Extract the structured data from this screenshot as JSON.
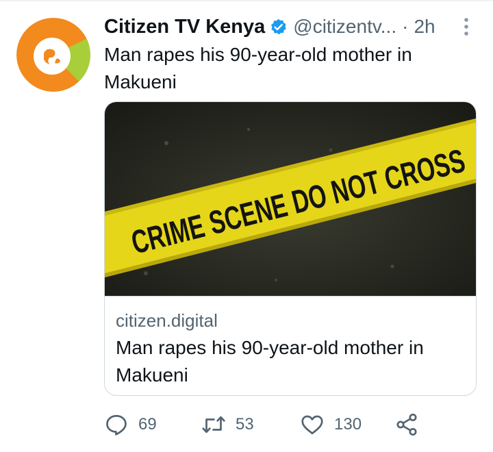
{
  "tweet": {
    "author_name": "Citizen TV Kenya",
    "handle": "@citizentv...",
    "separator": "·",
    "time": "2h",
    "text": "Man rapes his 90-year-old mother in Makueni",
    "avatar_colors": {
      "orange": "#f28a1e",
      "green": "#a8cf3a",
      "white": "#ffffff"
    },
    "verified_color": "#1d9bf0"
  },
  "card": {
    "image_text": "CRIME SCENE DO NOT CROSS",
    "image_colors": {
      "tape": "#e6d61a",
      "ground": "#2a2b22"
    },
    "domain": "citizen.digital",
    "title": "Man rapes his 90-year-old mother in Makueni"
  },
  "actions": {
    "reply_count": "69",
    "retweet_count": "53",
    "like_count": "130"
  }
}
